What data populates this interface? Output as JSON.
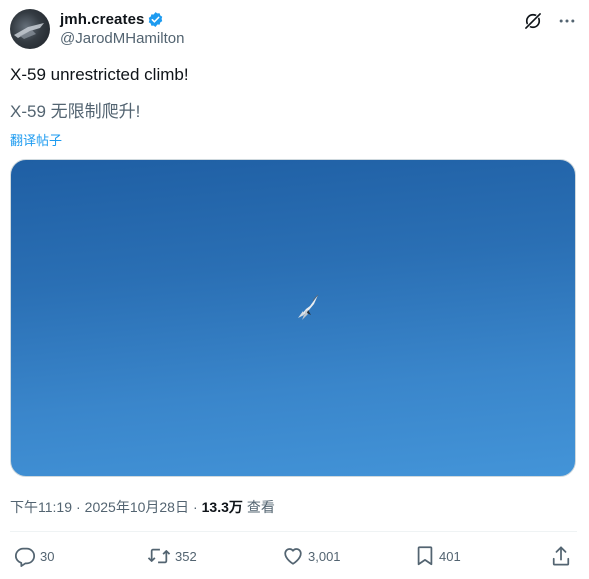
{
  "author": {
    "display_name": "jmh.creates",
    "handle": "@JarodMHamilton",
    "verified_icon": "verified-badge-icon"
  },
  "header_icons": {
    "grok": "grok-icon",
    "more": "more-icon"
  },
  "tweet": {
    "text": "X-59 unrestricted climb!",
    "translated_text": "X-59 无限制爬升!",
    "translate_link": "翻译帖子"
  },
  "media": {
    "description_icon": "aircraft-icon",
    "sky_top_color": "#1f5fa4",
    "sky_bottom_color": "#4394d8"
  },
  "meta": {
    "time": "下午11:19",
    "separator": "·",
    "date": "2025年10月28日",
    "views_count": "13.3万",
    "views_label": "查看"
  },
  "actions": {
    "reply_count": "30",
    "repost_count": "352",
    "like_count": "3,001",
    "bookmark_count": "401"
  },
  "colors": {
    "accent": "#1d9bf0",
    "secondary_text": "#536471",
    "primary_text": "#0f1419"
  }
}
